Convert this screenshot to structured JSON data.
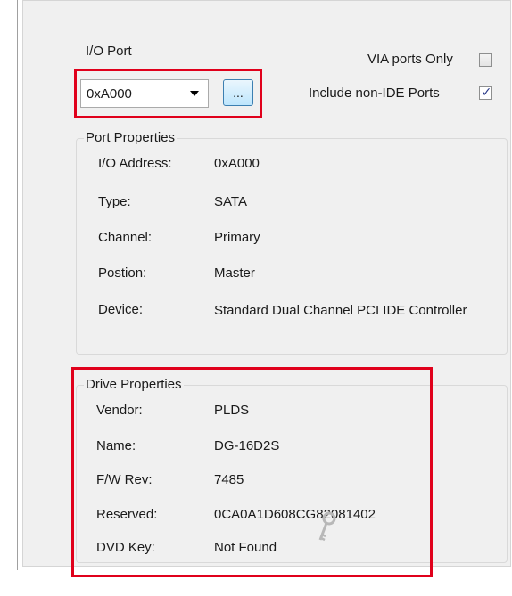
{
  "io_port": {
    "label": "I/O Port",
    "selected": "0xA000",
    "browse_label": "..."
  },
  "options": {
    "via_ports_only": {
      "label": "VIA ports Only",
      "checked": false
    },
    "include_non_ide": {
      "label": "Include non-IDE Ports",
      "checked": true
    }
  },
  "port_properties": {
    "title": "Port Properties",
    "rows": [
      {
        "key": "I/O Address:",
        "value": "0xA000"
      },
      {
        "key": "Type:",
        "value": "SATA"
      },
      {
        "key": "Channel:",
        "value": "Primary"
      },
      {
        "key": "Postion:",
        "value": "Master"
      },
      {
        "key": "Device:",
        "value": "Standard Dual Channel PCI IDE Controller"
      }
    ]
  },
  "drive_properties": {
    "title": "Drive Properties",
    "rows": [
      {
        "key": "Vendor:",
        "value": "PLDS"
      },
      {
        "key": "Name:",
        "value": "DG-16D2S"
      },
      {
        "key": "F/W Rev:",
        "value": "7485"
      },
      {
        "key": "Reserved:",
        "value": "0CA0A1D608CG82081402"
      },
      {
        "key": "DVD Key:",
        "value": "Not Found"
      }
    ]
  },
  "colors": {
    "highlight": "#e0001b",
    "panel": "#f0f0f0"
  }
}
